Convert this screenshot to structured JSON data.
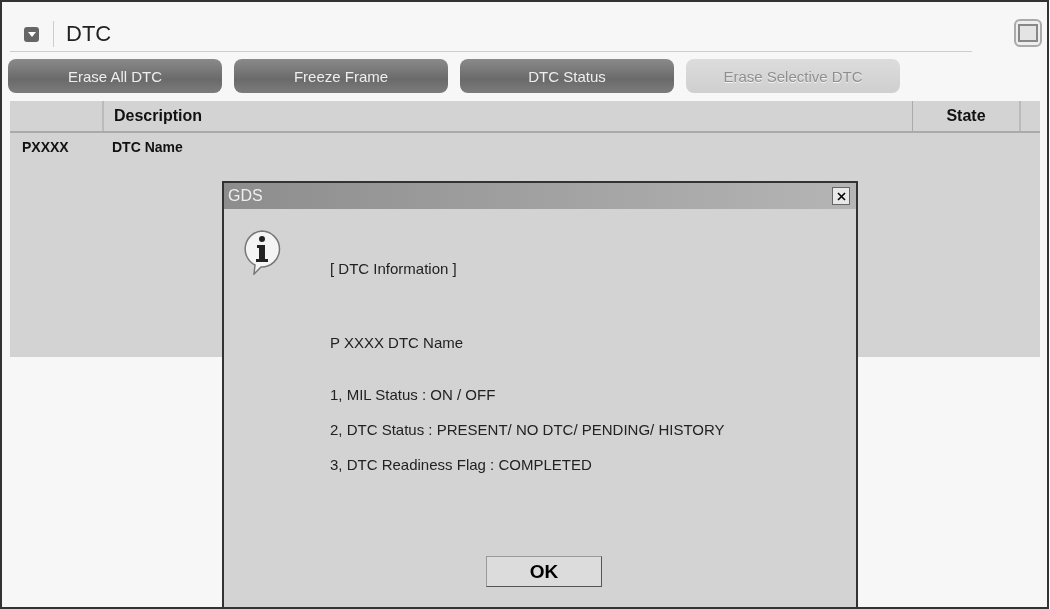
{
  "panel": {
    "title": "DTC",
    "expanded": true
  },
  "buttons": [
    {
      "label": "Erase All DTC",
      "disabled": false
    },
    {
      "label": "Freeze Frame",
      "disabled": false
    },
    {
      "label": "DTC Status",
      "disabled": false
    },
    {
      "label": "Erase Selective DTC",
      "disabled": true
    }
  ],
  "table": {
    "columns": [
      "Description",
      "State"
    ],
    "rows": [
      {
        "code": "PXXXX",
        "description": "DTC Name"
      }
    ]
  },
  "dialog": {
    "title": "GDS",
    "heading": "[ DTC Information ]",
    "code_line": "P XXXX DTC Name",
    "lines": [
      "1, MIL Status : ON / OFF",
      "2, DTC Status : PRESENT/ NO DTC/ PENDING/ HISTORY",
      "3, DTC Readiness Flag : COMPLETED"
    ],
    "ok": "OK"
  }
}
